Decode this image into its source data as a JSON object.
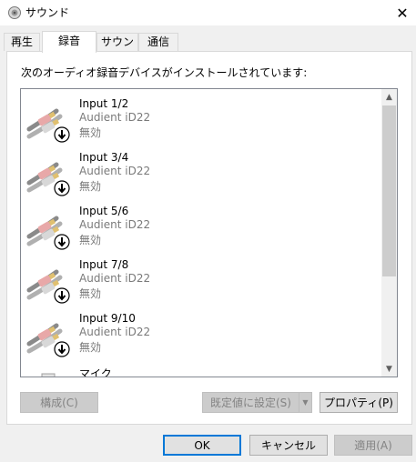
{
  "window": {
    "title": "サウンド",
    "close_symbol": "✕"
  },
  "tabs": [
    {
      "label": "再生"
    },
    {
      "label": "録音"
    },
    {
      "label": "サウンド"
    },
    {
      "label": "通信"
    }
  ],
  "instruction": "次のオーディオ録音デバイスがインストールされています:",
  "devices": [
    {
      "name": "Input 1/2",
      "driver": "Audient iD22",
      "status": "無効",
      "icon": "rca-cable-disabled-icon"
    },
    {
      "name": "Input 3/4",
      "driver": "Audient iD22",
      "status": "無効",
      "icon": "rca-cable-disabled-icon"
    },
    {
      "name": "Input 5/6",
      "driver": "Audient iD22",
      "status": "無効",
      "icon": "rca-cable-disabled-icon"
    },
    {
      "name": "Input 7/8",
      "driver": "Audient iD22",
      "status": "無効",
      "icon": "rca-cable-disabled-icon"
    },
    {
      "name": "Input 9/10",
      "driver": "Audient iD22",
      "status": "無効",
      "icon": "rca-cable-disabled-icon"
    },
    {
      "name": "マイク",
      "driver": "",
      "status": "",
      "icon": "microphone-device-icon"
    }
  ],
  "buttons": {
    "configure": "構成(C)",
    "set_default": "既定値に設定(S)",
    "properties": "プロパティ(P)",
    "ok": "OK",
    "cancel": "キャンセル",
    "apply": "適用(A)"
  },
  "colors": {
    "accent": "#0078d7",
    "disabled_text": "#838383",
    "secondary_text": "#7a7a7a"
  }
}
